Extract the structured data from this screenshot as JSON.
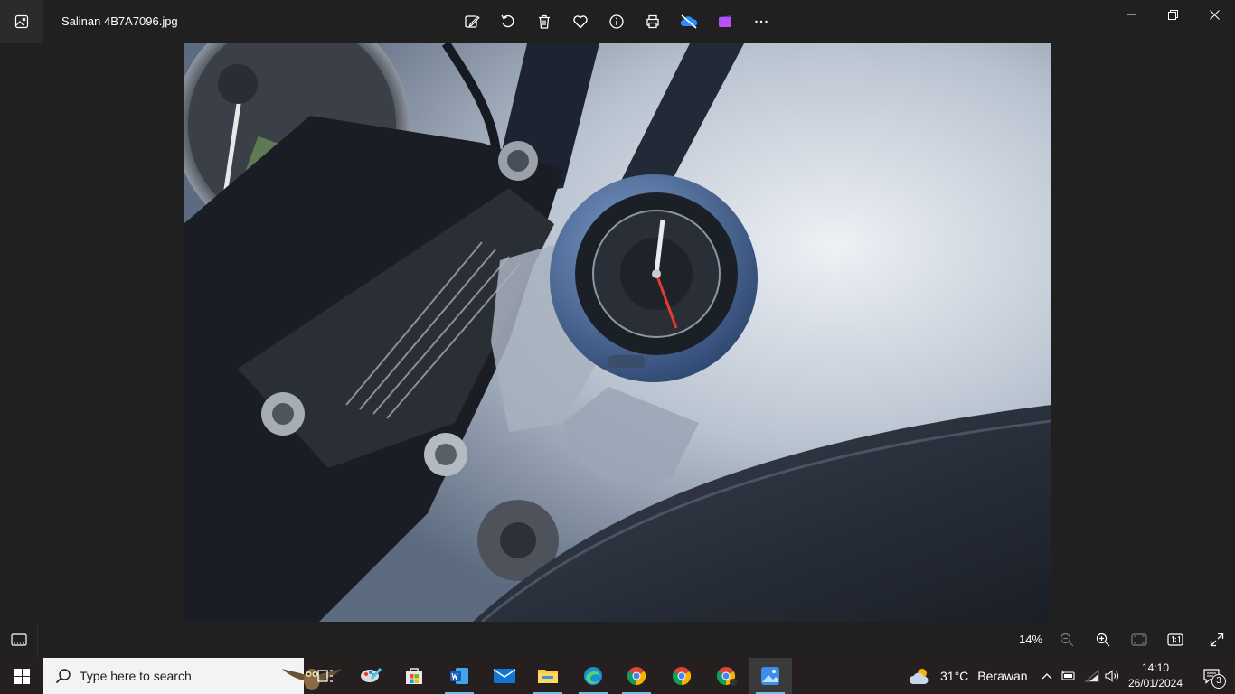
{
  "window": {
    "file_name": "Salinan 4B7A7096.jpg"
  },
  "toolbar": {
    "items": [
      "edit-image-icon",
      "rotate-icon",
      "delete-icon",
      "favorite-icon",
      "info-icon",
      "print-icon",
      "onedrive-off-icon",
      "clipchamp-icon",
      "more-icon"
    ]
  },
  "viewer": {
    "zoom": "14%"
  },
  "taskbar": {
    "search_placeholder": "Type here to search",
    "weather_temp": "31°C",
    "weather_desc": "Berawan",
    "time": "14:10",
    "date": "26/01/2024",
    "notification_count": "3"
  },
  "colors": {
    "accent": "#76b9ed",
    "titlebar_bg": "#202020",
    "taskbar_bg": "#251f1f"
  }
}
